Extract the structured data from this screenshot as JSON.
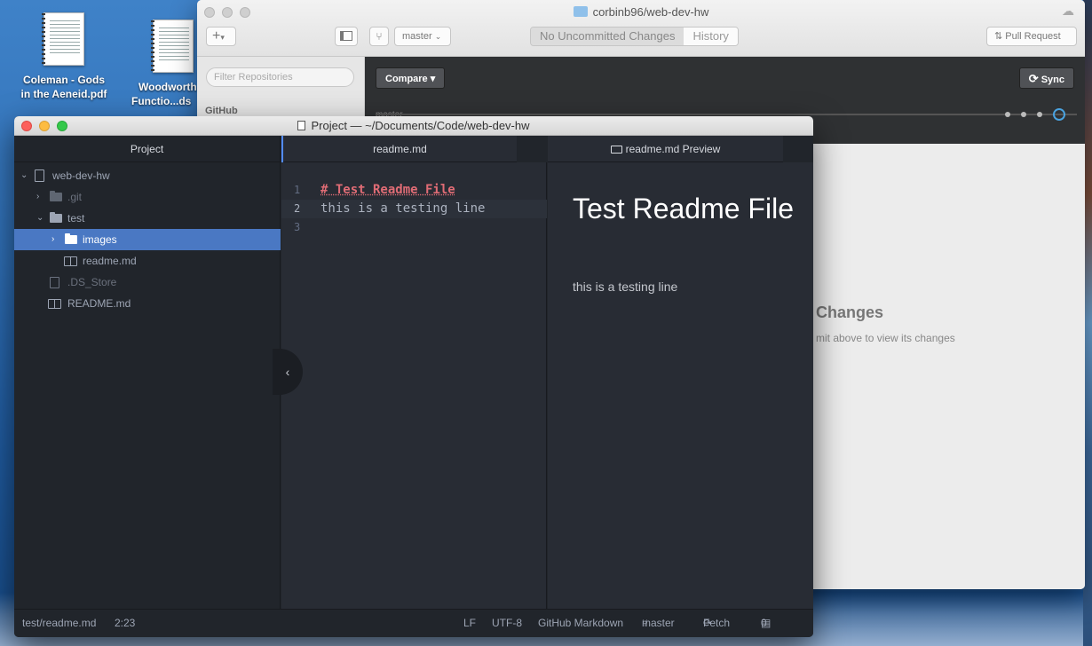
{
  "desktop": {
    "icons": [
      {
        "label_line1": "Coleman - Gods",
        "label_line2": "in the Aeneid.pdf"
      },
      {
        "label_line1": "Woodworth",
        "label_line2": "Functio...ds"
      }
    ]
  },
  "github": {
    "title": "corbinb96/web-dev-hw",
    "branch": "master",
    "segments": {
      "uncommitted": "No Uncommitted Changes",
      "history": "History"
    },
    "pull_request": "Pull Request",
    "filter_placeholder": "Filter Repositories",
    "sidebar_label": "GitHub",
    "compare": "Compare",
    "sync": "Sync",
    "timeline_branch": "master",
    "changes_title": "Changes",
    "changes_hint": "mit above to view its changes"
  },
  "atom": {
    "title": "Project — ~/Documents/Code/web-dev-hw",
    "tree": {
      "header": "Project",
      "root": "web-dev-hw",
      "items": [
        {
          "label": ".git"
        },
        {
          "label": "test"
        },
        {
          "label": "images"
        },
        {
          "label": "readme.md"
        },
        {
          "label": ".DS_Store"
        },
        {
          "label": "README.md"
        }
      ]
    },
    "editor": {
      "tab": "readme.md",
      "lines": [
        {
          "num": "1",
          "text": "# Test Readme File"
        },
        {
          "num": "2",
          "text": "this is a testing line"
        },
        {
          "num": "3",
          "text": ""
        }
      ]
    },
    "preview": {
      "tab": "readme.md Preview",
      "heading": "Test Readme File",
      "paragraph": "this is a testing line"
    },
    "status": {
      "path": "test/readme.md",
      "cursor": "2:23",
      "line_ending": "LF",
      "encoding": "UTF-8",
      "grammar": "GitHub Markdown",
      "branch": "master",
      "fetch": "Fetch",
      "files": "0 files"
    }
  }
}
